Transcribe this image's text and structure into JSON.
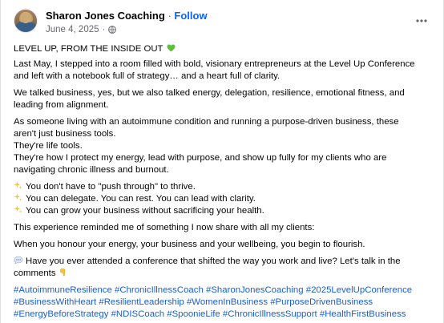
{
  "author": {
    "name": "Sharon Jones Coaching",
    "separator": "·",
    "follow_label": "Follow",
    "date": "June 4, 2025",
    "meta_separator": "·",
    "privacy_icon": "globe-icon"
  },
  "menu": {
    "icon": "more-horizontal-icon"
  },
  "post": {
    "headline": "LEVEL UP, FROM THE INSIDE OUT",
    "headline_icon": "green-heart-icon",
    "p1": "Last May, I stepped into a room filled with bold, visionary entrepreneurs at the Level Up Conference and left with a notebook full of strategy… and a heart full of clarity.",
    "p2": "We talked business, yes, but we also talked energy, delegation, resilience, emotional fitness, and leading from alignment.",
    "p3_lines": [
      "As someone living with an autoimmune condition and running a purpose-driven business, these aren't just business tools.",
      "They're life tools.",
      "They're how I protect my energy, lead with purpose, and show up fully for my clients who are navigating chronic illness and burnout."
    ],
    "sparkle_lines": [
      "You don't have to \"push through\" to thrive.",
      "You can delegate. You can rest. You can lead with clarity.",
      "You can grow your business without sacrificing your health."
    ],
    "sparkle_icon": "sparkles-icon",
    "p5": "This experience reminded me of something I now share with all my clients:",
    "p6": "When you honour your energy, your business and your wellbeing, you begin to flourish.",
    "question": "Have you ever attended a conference that shifted the way you work and live? Let's talk in the comments",
    "question_icon": "speech-bubble-icon",
    "question_end_icon": "pointing-down-icon",
    "hashtags": [
      "#AutoimmuneResilience",
      "#ChronicIllnessCoach",
      "#SharonJonesCoaching",
      "#2025LevelUpConference",
      "#BusinessWithHeart",
      "#ResilientLeadership",
      "#WomenInBusiness",
      "#PurposeDrivenBusiness",
      "#EnergyBeforeStrategy",
      "#NDISCoach",
      "#SpoonieLife",
      "#ChronicIllnessSupport",
      "#HealthFirstBusiness"
    ]
  },
  "colors": {
    "link": "#0866ff",
    "text": "#050505",
    "secondary": "#65676b",
    "heart": "#5fbf3a"
  }
}
